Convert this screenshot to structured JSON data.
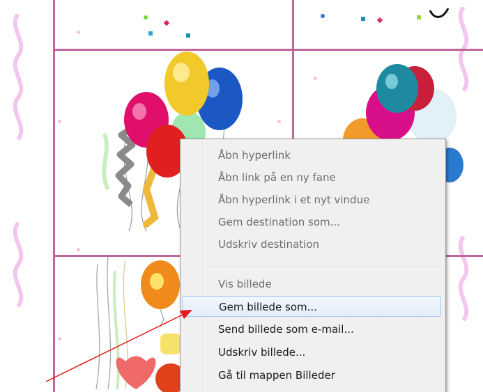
{
  "context_menu": {
    "items": [
      {
        "label": "Åbn hyperlink",
        "enabled": false
      },
      {
        "label": "Åbn link på en ny fane",
        "enabled": false
      },
      {
        "label": "Åbn hyperlink i et nyt vindue",
        "enabled": false
      },
      {
        "label": "Gem destination som...",
        "enabled": false
      },
      {
        "label": "Udskriv destination",
        "enabled": false
      },
      {
        "label": "Vis billede",
        "enabled": false
      },
      {
        "label": "Gem billede som...",
        "enabled": true,
        "highlighted": true
      },
      {
        "label": "Send billede som e-mail...",
        "enabled": true
      },
      {
        "label": "Udskriv billede...",
        "enabled": true
      },
      {
        "label": "Gå til mappen Billeder",
        "enabled": true
      }
    ]
  },
  "colors": {
    "grid": "#c0649c",
    "pointer_arrow": "#e8191c",
    "menu_bg": "#f0f0f0",
    "highlight": "#dce9f9"
  },
  "icons": [
    "pointer-arrow-icon"
  ]
}
